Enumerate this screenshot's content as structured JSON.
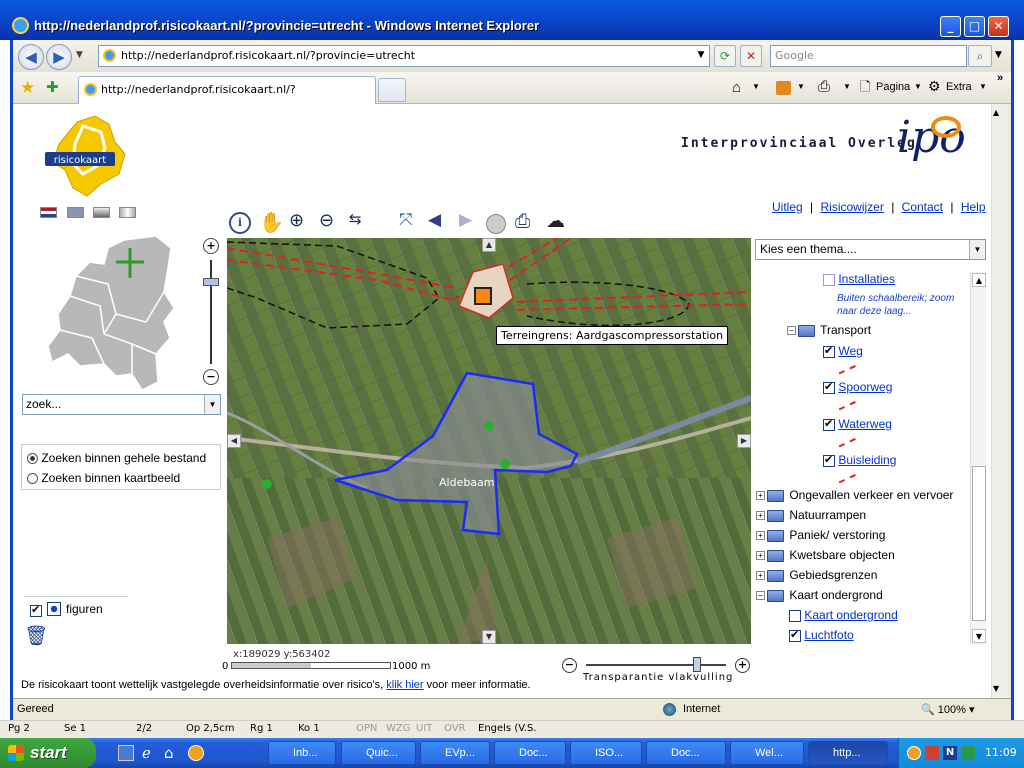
{
  "window": {
    "title": "http://nederlandprof.risicokaart.nl/?provincie=utrecht - Windows Internet Explorer",
    "minimize": "_",
    "maximize": "□",
    "close": "✕"
  },
  "browser": {
    "address": "http://nederlandprof.risicokaart.nl/?provincie=utrecht",
    "search_placeholder": "Google",
    "tab_title": "http://nederlandprof.risicokaart.nl/?provincie=utrecht",
    "toolbar": {
      "pagina": "Pagina",
      "extra": "Extra"
    }
  },
  "page": {
    "logo_text": "risicokaart",
    "header_org": "Interprovinciaal Overleg",
    "ipo_logo": "ipo",
    "nav_links": [
      "Uitleg",
      "Risicowijzer",
      "Contact",
      "Help"
    ],
    "nav_sep": "|",
    "search_placeholder": "zoek...",
    "search_options": [
      "Zoeken binnen gehele bestand",
      "Zoeken binnen kaartbeeld"
    ],
    "figures_label": "figuren",
    "map_tooltip": "Terreingrens: Aardgascompressorstation",
    "map_place": "Aldebaam",
    "coords": "x:189029 y:563402",
    "scale": {
      "start": "0",
      "end": "1000 m"
    },
    "transparency_label": "Transparantie vlakvulling",
    "transparency_value": 0.84,
    "theme_select": "Kies een thema....",
    "footer_text": "De risicokaart toont wettelijk vastgelegde overheidsinformatie over risico's,",
    "footer_link": "klik hier",
    "footer_after": "voor meer informatie.",
    "layers": {
      "installaties": "Installaties",
      "installaties_note": "Buiten schaalbereik; zoom naar deze laag...",
      "transport": "Transport",
      "weg": "Weg",
      "spoorweg": "Spoorweg",
      "waterweg": "Waterweg",
      "buisleiding": "Buisleiding",
      "groups": [
        "Ongevallen verkeer en vervoer",
        "Natuurrampen",
        "Paniek/ verstoring",
        "Kwetsbare objecten",
        "Gebiedsgrenzen",
        "Kaart ondergrond"
      ],
      "kaart_ondergrond": "Kaart ondergrond",
      "luchtfoto": "Luchtfoto"
    }
  },
  "status": {
    "text": "Gereed",
    "zone": "Internet",
    "zoom": "100%"
  },
  "wordstrip": {
    "items": [
      "Pg 2",
      "Se 1",
      "2/2",
      "Op 2,5cm",
      "Rg 1",
      "Ko 1",
      "OPN",
      "WZG",
      "UIT",
      "OVR",
      "Engels (V.S."
    ]
  },
  "taskbar": {
    "start": "start",
    "tasks": [
      "Inb...",
      "Quic...",
      "EVp...",
      "Doc...",
      "ISO...",
      "Doc...",
      "Wel...",
      "http..."
    ],
    "clock": "11:09"
  },
  "colors": {
    "xp_blue": "#0a45d0",
    "link": "#0033cc",
    "contour_red": "#e02020",
    "selection_blue": "#1a2aff"
  }
}
